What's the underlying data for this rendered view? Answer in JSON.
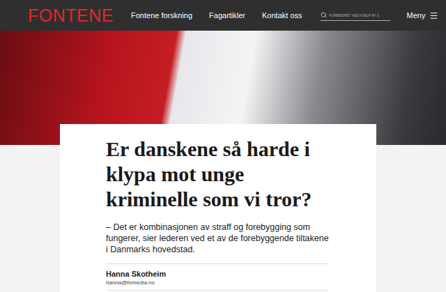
{
  "header": {
    "logo": "FONTENE",
    "nav": [
      {
        "label": "Fontene forskning",
        "selected": false
      },
      {
        "label": "Fagartikler",
        "selected": false
      },
      {
        "label": "Kontakt oss",
        "selected": false
      }
    ],
    "search": {
      "placeholder": "FORBEDRET VED HJELP AV G"
    },
    "menu": "Meny"
  },
  "article": {
    "title": "Er danskene så harde i klypa mot unge kriminelle som vi tror?",
    "lede": "– Det er kombinasjonen av straff og forebygging som fungerer, sier lederen ved et av de forebyggende tiltakene i Danmarks hovedstad.",
    "author": {
      "name": "Hanna Skotheim",
      "email": "hanna@fomedia.no"
    }
  }
}
